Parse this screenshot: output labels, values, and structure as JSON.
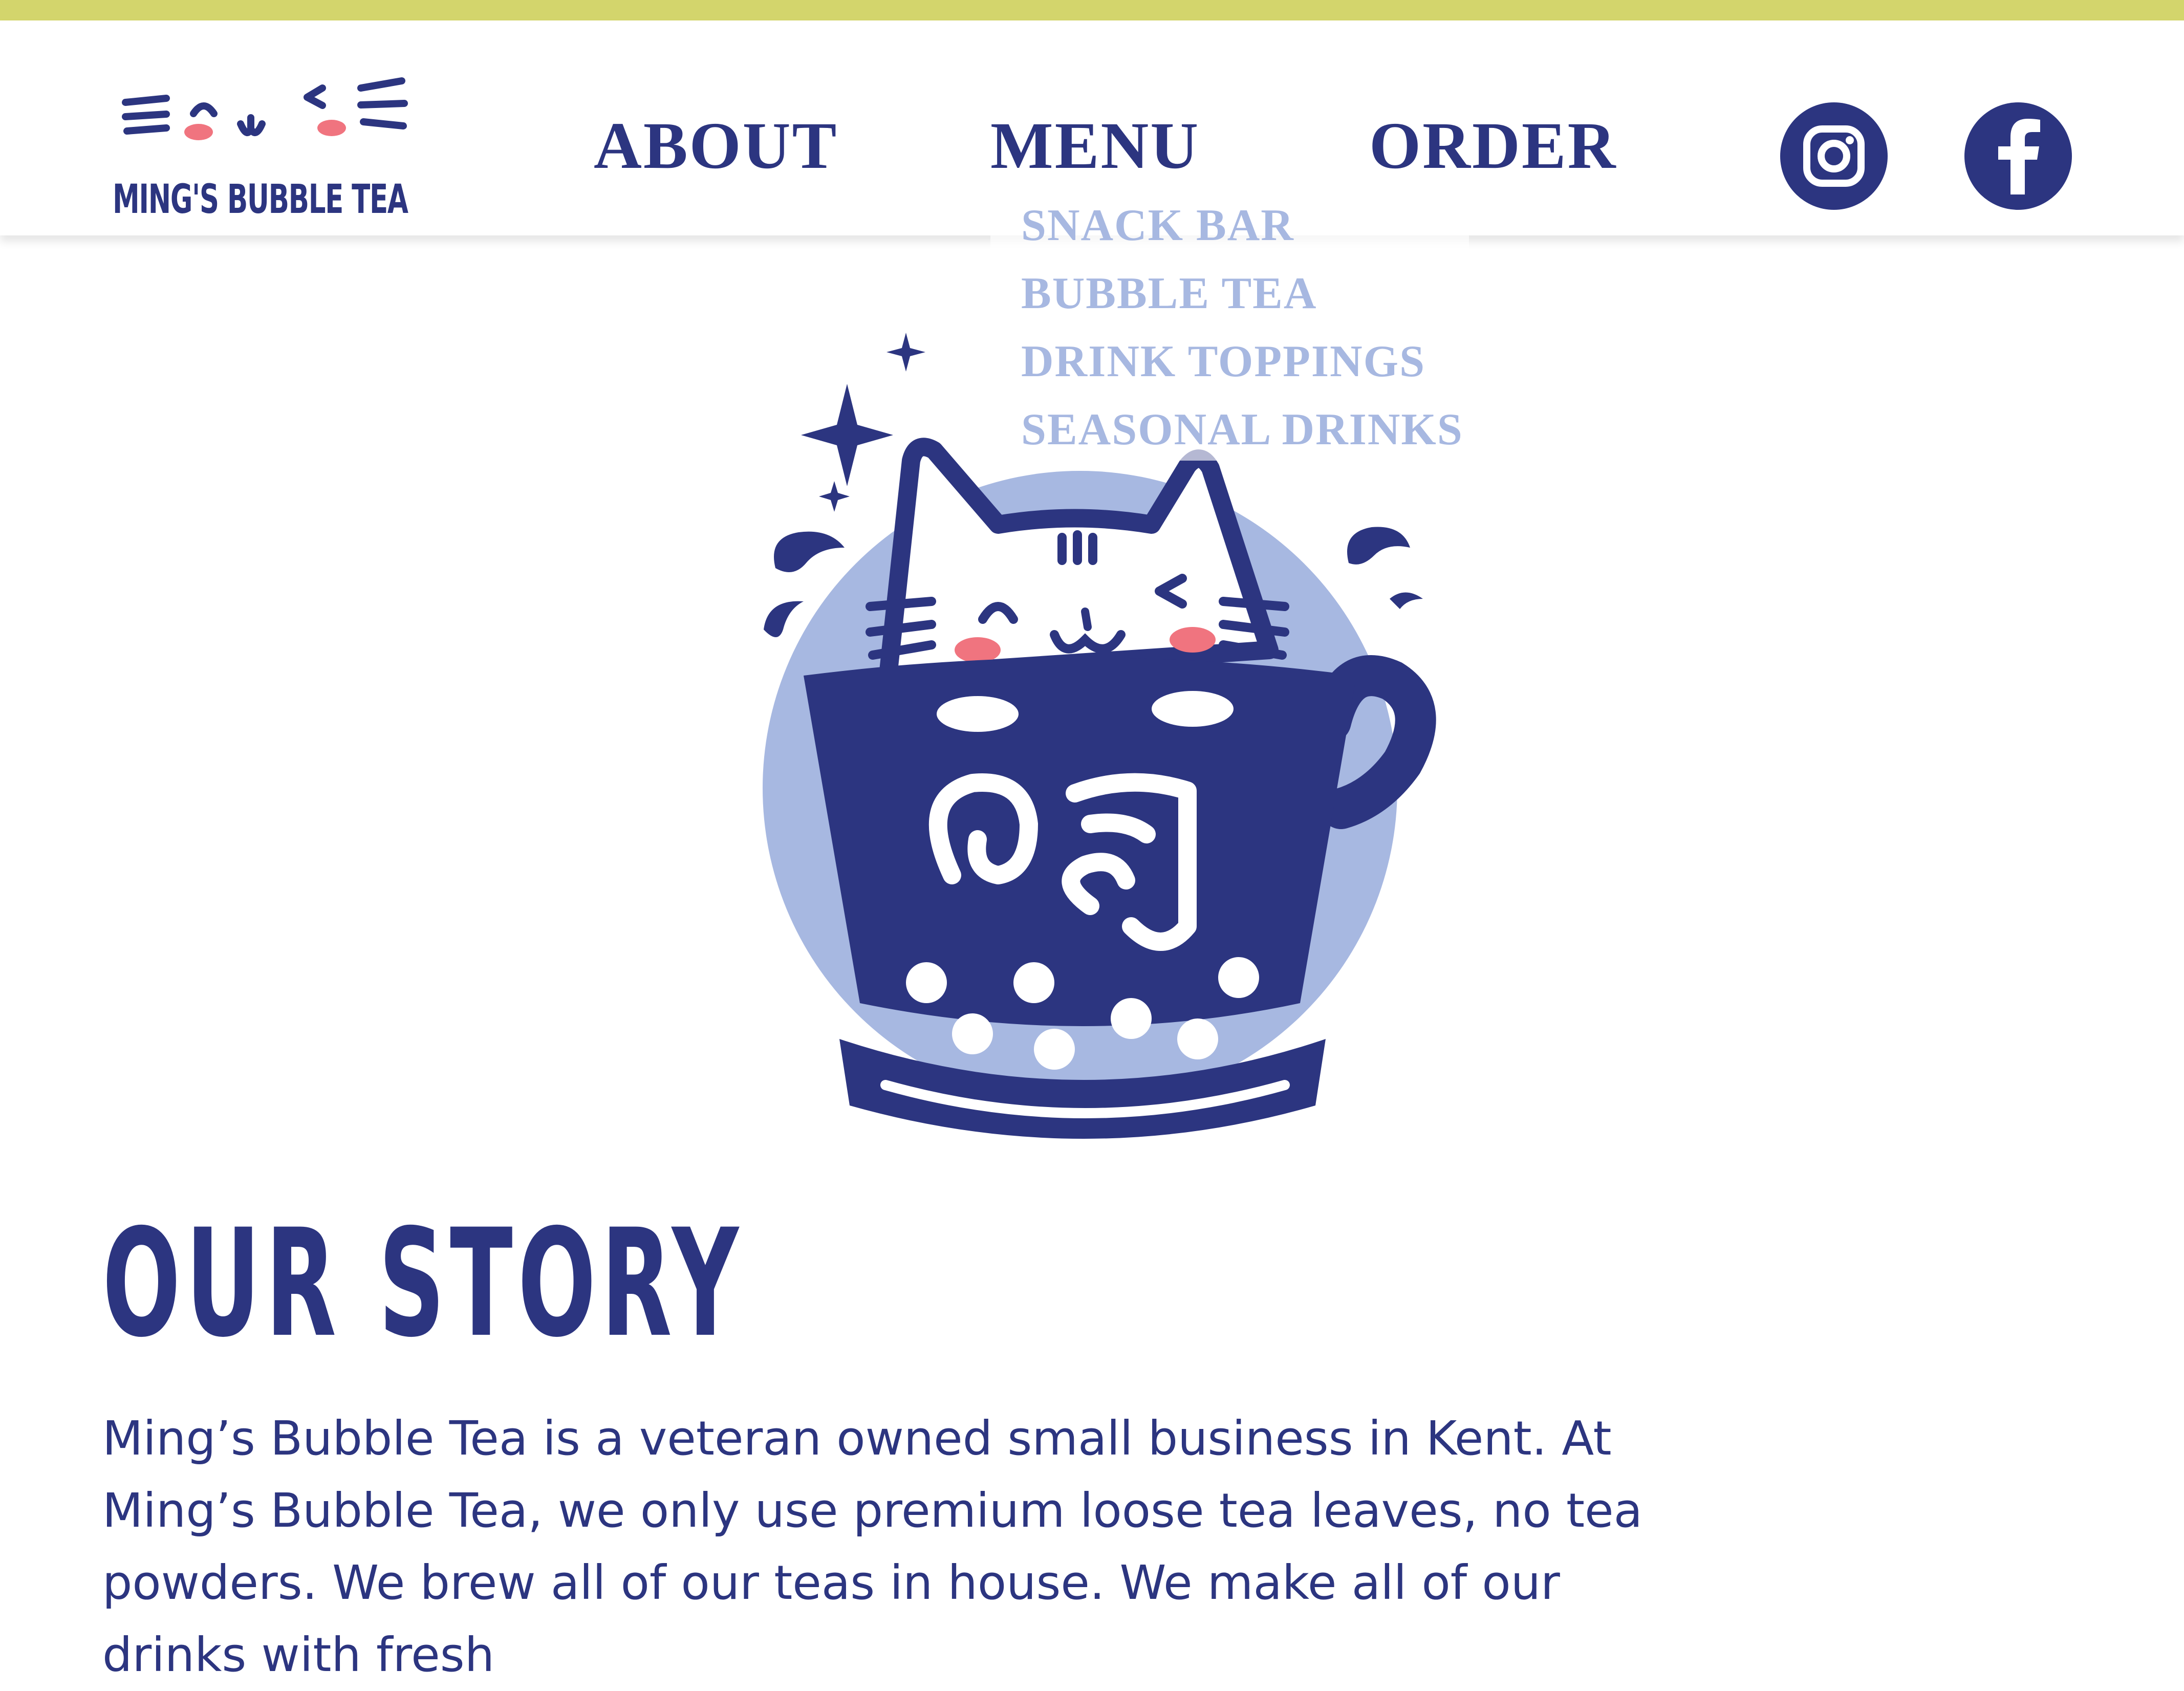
{
  "brand": {
    "name": "MING'S BUBBLE TEA"
  },
  "nav": {
    "items": [
      {
        "label": "ABOUT"
      },
      {
        "label": "MENU"
      },
      {
        "label": "ORDER"
      }
    ],
    "menu_dropdown": [
      "SNACK BAR",
      "BUBBLE TEA",
      "DRINK TOPPINGS",
      "SEASONAL DRINKS"
    ]
  },
  "social": {
    "icons": [
      "instagram-icon",
      "facebook-icon"
    ]
  },
  "hero": {
    "mug_glyph": "明"
  },
  "story": {
    "title": "OUR STORY",
    "body": "Ming’s Bubble Tea is a veteran owned small business in Kent. At Ming’s Bubble Tea, we only use premium loose tea leaves, no tea powders. We brew all of our teas in house. We make all of our drinks with fresh"
  },
  "colors": {
    "navy": "#2c3580",
    "light_blue": "#a7b8e1",
    "lime": "#d3d56c",
    "pink": "#f0747f",
    "white": "#ffffff"
  }
}
